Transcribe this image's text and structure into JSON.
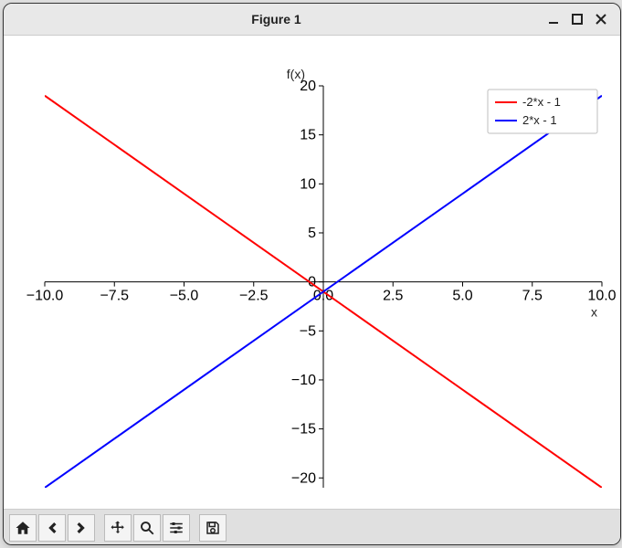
{
  "window": {
    "title": "Figure 1"
  },
  "chart_data": {
    "type": "line",
    "xlabel": "x",
    "ylabel": "f(x)",
    "xlim": [
      -10,
      10
    ],
    "ylim": [
      -21,
      20
    ],
    "xticks": [
      -10.0,
      -7.5,
      -5.0,
      -2.5,
      0.0,
      2.5,
      5.0,
      7.5,
      10.0
    ],
    "yticks": [
      -20,
      -15,
      -10,
      -5,
      0,
      5,
      10,
      15,
      20
    ],
    "xtick_labels": [
      "−10.0",
      "−7.5",
      "−5.0",
      "−2.5",
      "0.0",
      "2.5",
      "5.0",
      "7.5",
      "10.0"
    ],
    "ytick_labels": [
      "−20",
      "−15",
      "−10",
      "−5",
      "0",
      "5",
      "10",
      "15",
      "20"
    ],
    "series": [
      {
        "name": "-2*x - 1",
        "color": "#ff0000",
        "x": [
          -10,
          10
        ],
        "y": [
          19,
          -21
        ]
      },
      {
        "name": "2*x - 1",
        "color": "#0000ff",
        "x": [
          -10,
          10
        ],
        "y": [
          -21,
          19
        ]
      }
    ]
  },
  "toolbar": {
    "home": "Home",
    "back": "Back",
    "forward": "Forward",
    "pan": "Pan",
    "zoom": "Zoom",
    "subplots": "Configure subplots",
    "save": "Save"
  }
}
